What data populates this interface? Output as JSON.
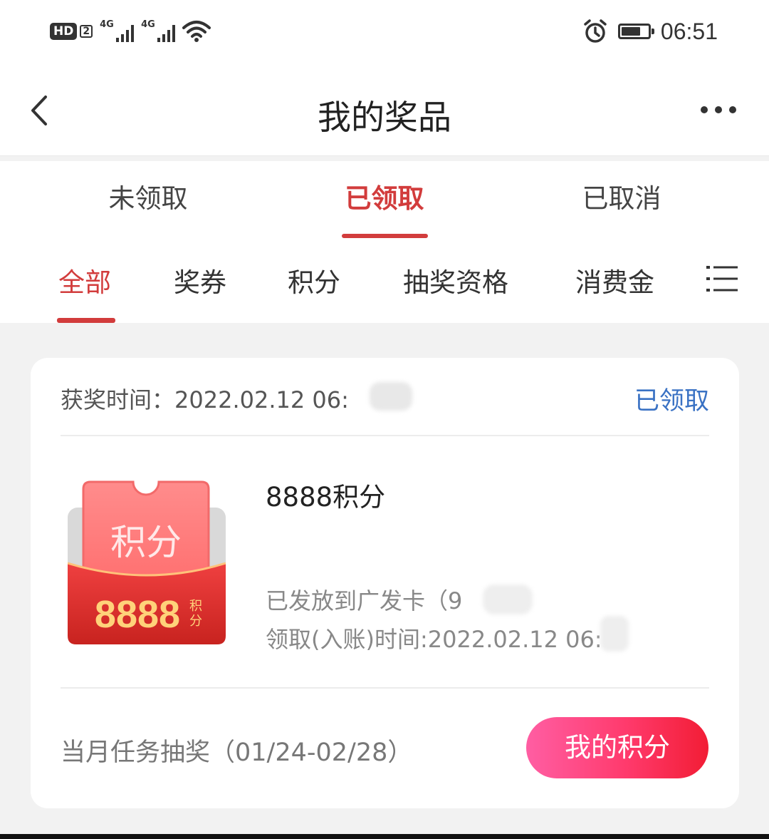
{
  "status_bar": {
    "hd_label": "HD",
    "sim_label": "2",
    "network1": "4G",
    "network2": "4G",
    "time": "06:51",
    "icons": [
      "hd-icon",
      "signal-icon",
      "wifi-icon",
      "alarm-icon",
      "battery-icon"
    ]
  },
  "header": {
    "title": "我的奖品",
    "back_icon": "chevron-left-icon",
    "more_icon": "more-horizontal-icon"
  },
  "status_tabs": [
    {
      "label": "未领取",
      "active": false
    },
    {
      "label": "已领取",
      "active": true
    },
    {
      "label": "已取消",
      "active": false
    }
  ],
  "type_tabs": [
    {
      "label": "全部",
      "active": true
    },
    {
      "label": "奖券",
      "active": false
    },
    {
      "label": "积分",
      "active": false
    },
    {
      "label": "抽奖资格",
      "active": false
    },
    {
      "label": "消费金",
      "active": false
    }
  ],
  "type_menu_icon": "list-icon",
  "prize_card": {
    "award_time_label": "获奖时间：2022.02.12 06:",
    "status": "已领取",
    "prize_image": {
      "title": "积分",
      "amount": "8888",
      "unit_top": "积",
      "unit_bottom": "分"
    },
    "prize_name": "8888积分",
    "delivery_info": "已发放到广发卡（9",
    "delivery_info_end": "）",
    "receive_time": "领取(入账)时间:2022.02.12 06:",
    "activity": "当月任务抽奖（01/24-02/28）",
    "action_button": "我的积分"
  },
  "colors": {
    "accent_red": "#d23c3c",
    "status_blue": "#3a72c4",
    "button_gradient_start": "#ff5ea3",
    "button_gradient_end": "#f21d35",
    "page_background": "#f2f2f2"
  }
}
